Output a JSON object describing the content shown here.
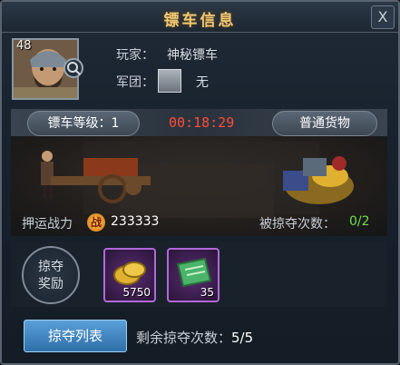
{
  "window": {
    "title": "镖车信息",
    "close_label": "X"
  },
  "player": {
    "level": "48",
    "name_label": "玩家：",
    "name": "神秘镖车",
    "guild_label": "军团：",
    "guild": "无"
  },
  "cart": {
    "grade_label": "镖车等级：",
    "grade": "1",
    "timer": "00:18:29",
    "cargo": "普通货物"
  },
  "stats": {
    "power_label": "押运战力",
    "power_icon": "战",
    "power": "233333",
    "robbed_label": "被掠夺次数：",
    "robbed": "0/2"
  },
  "rewards": {
    "label": "掠夺奖励",
    "items": [
      {
        "icon": "gold-coins-icon",
        "count": "5750"
      },
      {
        "icon": "green-book-icon",
        "count": "35"
      }
    ]
  },
  "footer": {
    "list_button": "掠夺列表",
    "remaining_label": "剩余掠夺次数：",
    "remaining": "5/5"
  },
  "colors": {
    "title": "#f0c878",
    "timer": "#ff4b3a",
    "robbed": "#6de04a",
    "button": "#3f86c2"
  }
}
